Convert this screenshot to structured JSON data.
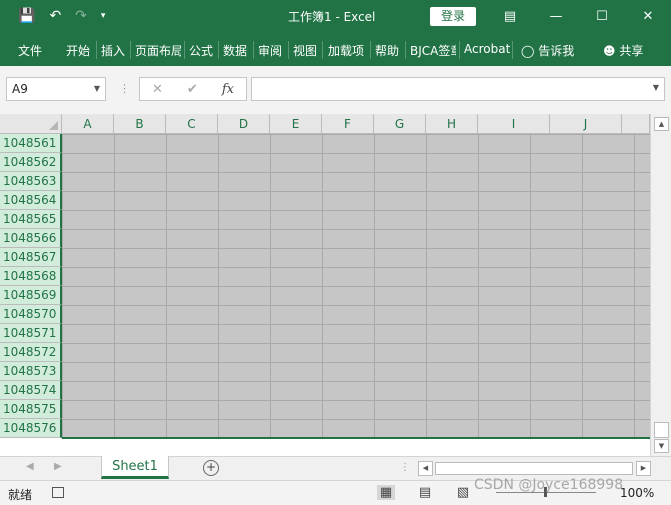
{
  "window": {
    "title": "工作簿1  -  Excel",
    "login_label": "登录",
    "qat": {
      "save_icon": "save-icon",
      "undo_icon": "undo-icon",
      "redo_icon": "redo-icon",
      "customize_icon": "chevron-down-icon"
    },
    "buttons": {
      "ribbon_display": "ribbon-display-icon",
      "minimize": "minimize-icon",
      "maximize": "maximize-icon",
      "close": "close-icon"
    }
  },
  "ribbon": {
    "tabs": [
      "文件",
      "开始",
      "插入",
      "页面布局",
      "公式",
      "数据",
      "审阅",
      "视图",
      "加载项",
      "帮助",
      "BJCA签章",
      "Acrobat"
    ],
    "tell_me": "告诉我",
    "share": "共享"
  },
  "formula_bar": {
    "name_box": "A9",
    "cancel_symbol": "✕",
    "enter_symbol": "✔",
    "fx_label": "fx",
    "formula_value": ""
  },
  "grid": {
    "columns": [
      "A",
      "B",
      "C",
      "D",
      "E",
      "F",
      "G",
      "H",
      "I",
      "J"
    ],
    "rows": [
      "1048561",
      "1048562",
      "1048563",
      "1048564",
      "1048565",
      "1048566",
      "1048567",
      "1048568",
      "1048569",
      "1048570",
      "1048571",
      "1048572",
      "1048573",
      "1048574",
      "1048575",
      "1048576"
    ]
  },
  "sheets": {
    "tabs": [
      "Sheet1"
    ],
    "add_sheet_symbol": "⊕"
  },
  "status": {
    "text": "就绪",
    "zoom": "100%"
  },
  "watermark": "CSDN @Joyce168998",
  "colors": {
    "accent": "#217346",
    "cell_fill": "#c6c6c6",
    "row_header_fill": "#d2ecdc"
  }
}
